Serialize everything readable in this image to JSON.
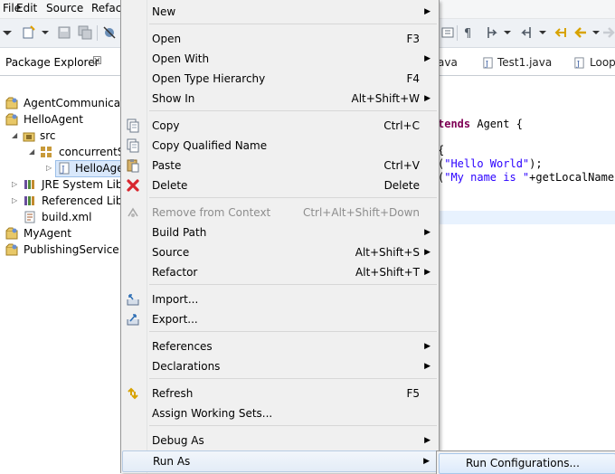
{
  "menubar": {
    "items": [
      "File",
      "Edit",
      "Source",
      "Refact"
    ]
  },
  "package_explorer": {
    "title": "Package Explorer",
    "close_glyph": "☒",
    "tree": [
      {
        "label": "AgentCommunicati",
        "icon": "project-icon"
      },
      {
        "label": "HelloAgent",
        "icon": "project-icon"
      },
      {
        "label": "src",
        "icon": "source-folder-icon"
      },
      {
        "label": "concurrentSy",
        "icon": "package-icon"
      },
      {
        "label": "HelloAge",
        "icon": "java-file-icon"
      },
      {
        "label": "JRE System Libra",
        "icon": "library-icon"
      },
      {
        "label": "Referenced Libra",
        "icon": "library-icon"
      },
      {
        "label": "build.xml",
        "icon": "xml-file-icon"
      },
      {
        "label": "MyAgent",
        "icon": "project-icon"
      },
      {
        "label": "PublishingService",
        "icon": "project-icon"
      }
    ]
  },
  "editor": {
    "tabs": [
      "ava",
      "Test1.java",
      "Loop"
    ],
    "code": {
      "line1_kw": "tends",
      "line1_rest": " Agent {",
      "line2": "{",
      "line3_pre": "(",
      "line3_str": "\"Hello World\"",
      "line3_post": ");",
      "line4_pre": "(",
      "line4_str": "\"My name is \"",
      "line4_post": "+getLocalName("
    }
  },
  "context_menu": {
    "items": {
      "new": {
        "label": "New"
      },
      "open": {
        "label": "Open",
        "shortcut": "F3"
      },
      "open_with": {
        "label": "Open With"
      },
      "open_type_hierarchy": {
        "label": "Open Type Hierarchy",
        "shortcut": "F4"
      },
      "show_in": {
        "label": "Show In",
        "shortcut": "Alt+Shift+W"
      },
      "copy": {
        "label": "Copy",
        "shortcut": "Ctrl+C"
      },
      "copy_qualified_name": {
        "label": "Copy Qualified Name"
      },
      "paste": {
        "label": "Paste",
        "shortcut": "Ctrl+V"
      },
      "delete": {
        "label": "Delete",
        "shortcut": "Delete"
      },
      "remove_from_context": {
        "label": "Remove from Context",
        "shortcut": "Ctrl+Alt+Shift+Down"
      },
      "build_path": {
        "label": "Build Path"
      },
      "source": {
        "label": "Source",
        "shortcut": "Alt+Shift+S"
      },
      "refactor": {
        "label": "Refactor",
        "shortcut": "Alt+Shift+T"
      },
      "import": {
        "label": "Import..."
      },
      "export": {
        "label": "Export..."
      },
      "references": {
        "label": "References"
      },
      "declarations": {
        "label": "Declarations"
      },
      "refresh": {
        "label": "Refresh",
        "shortcut": "F5"
      },
      "assign_working_sets": {
        "label": "Assign Working Sets..."
      },
      "debug_as": {
        "label": "Debug As"
      },
      "run_as": {
        "label": "Run As"
      }
    },
    "submenu_arrow": "▶"
  },
  "run_as_submenu": {
    "items": [
      {
        "label": "Run Configurations..."
      }
    ]
  }
}
